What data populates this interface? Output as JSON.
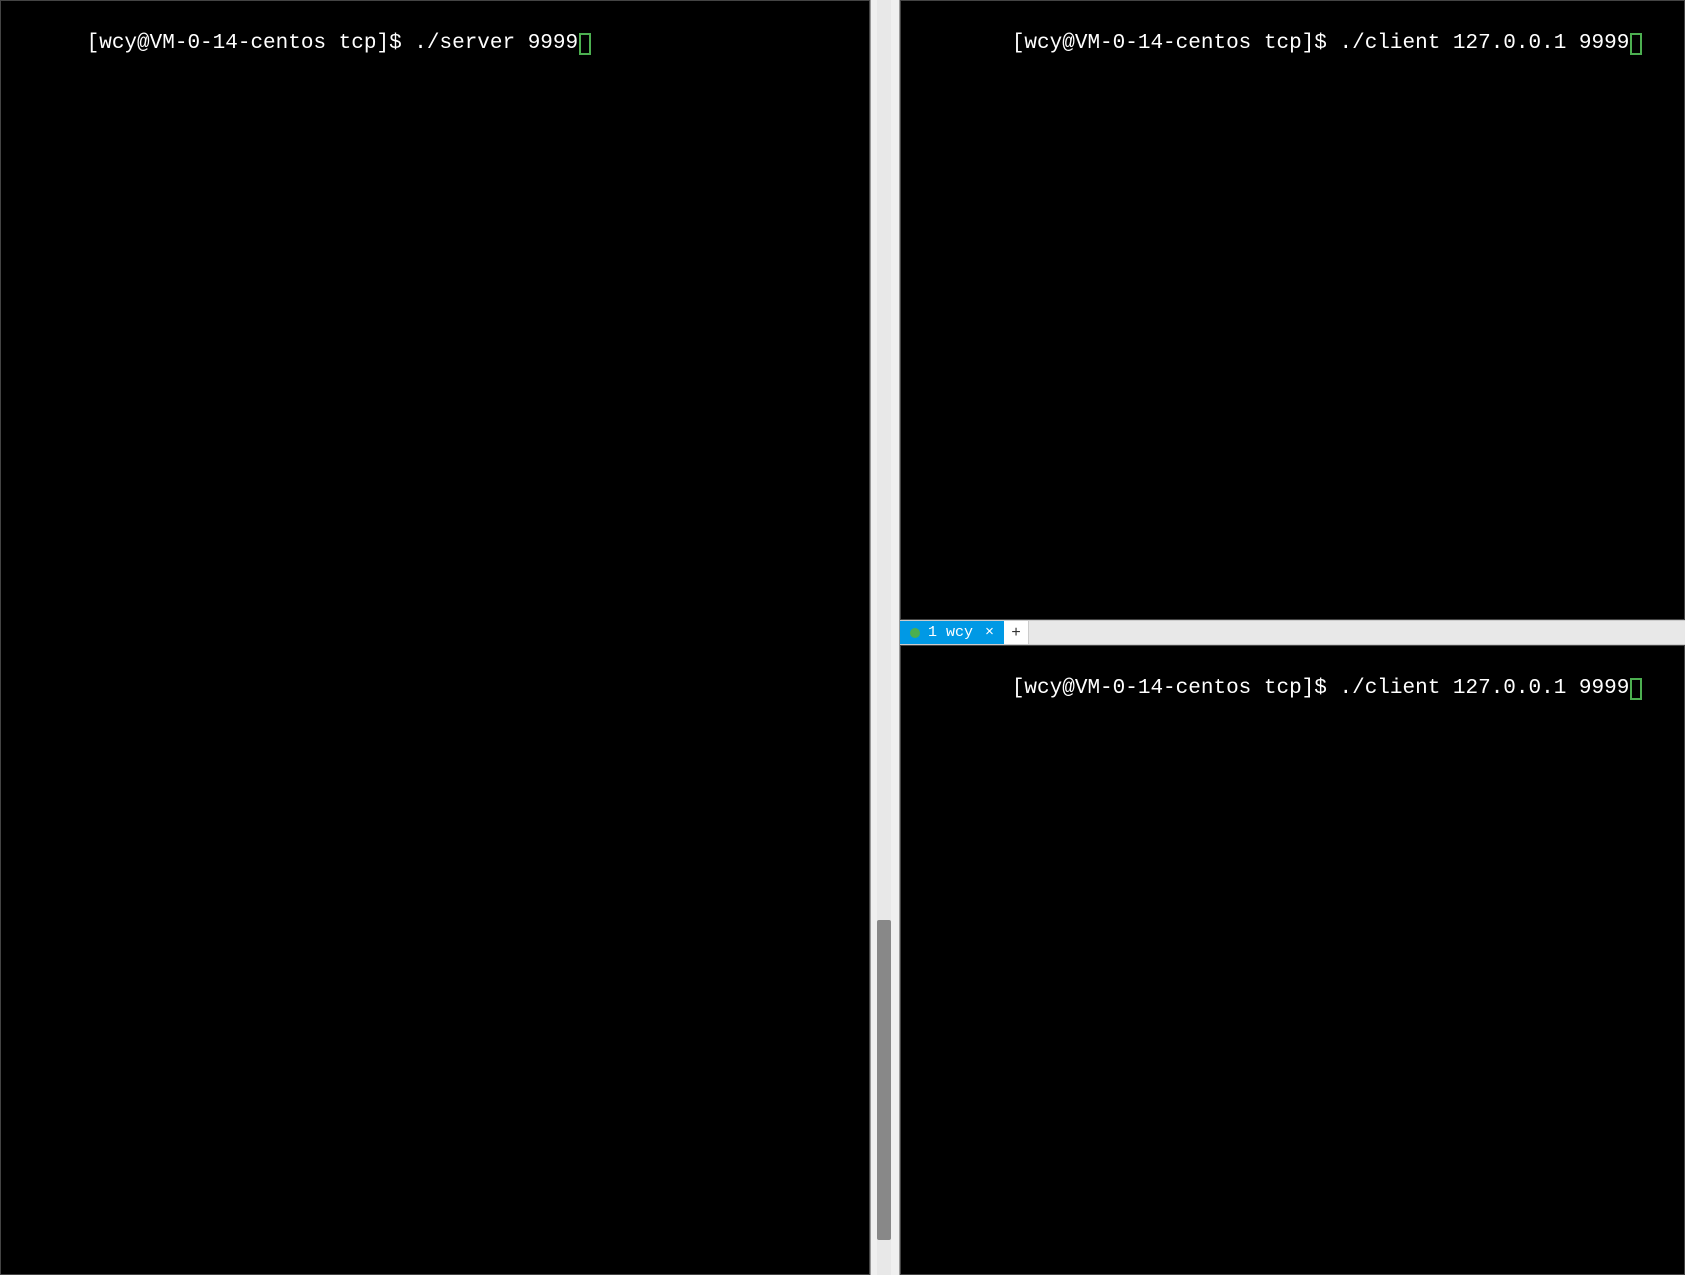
{
  "left_pane": {
    "prompt": "[wcy@VM-0-14-centos tcp]$ ",
    "command": "./server 9999"
  },
  "right_top_pane": {
    "prompt": "[wcy@VM-0-14-centos tcp]$ ",
    "command": "./client 127.0.0.1 9999"
  },
  "right_bottom_pane": {
    "prompt": "[wcy@VM-0-14-centos tcp]$ ",
    "command": "./client 127.0.0.1 9999"
  },
  "tab": {
    "label": "1 wcy",
    "close_symbol": "×",
    "add_symbol": "+"
  }
}
